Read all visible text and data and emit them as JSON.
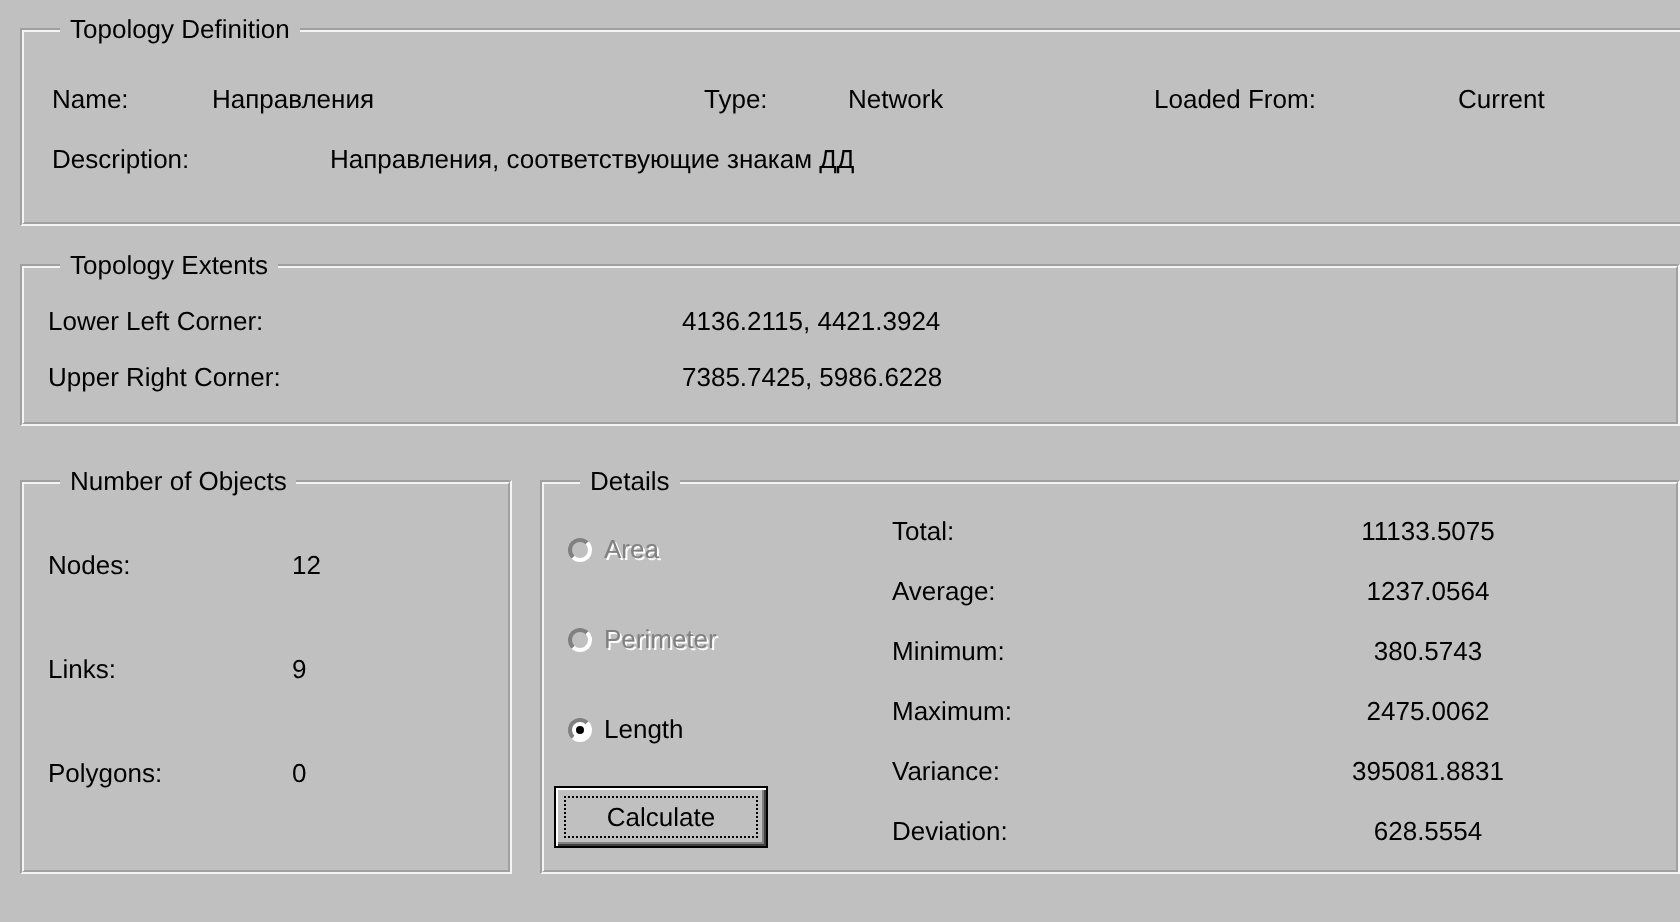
{
  "definition": {
    "title": "Topology Definition",
    "fields": [
      {
        "label": "Name:",
        "value": "Направления"
      },
      {
        "label": "Type:",
        "value": "Network"
      },
      {
        "label": "Loaded From:",
        "value": "Current"
      }
    ],
    "description": {
      "label": "Description:",
      "value": "Направления, соответствующие знакам ДД"
    }
  },
  "extents": {
    "title": "Topology Extents",
    "rows": [
      {
        "label": "Lower Left Corner:",
        "value": "4136.2115, 4421.3924"
      },
      {
        "label": "Upper Right Corner:",
        "value": "7385.7425, 5986.6228"
      }
    ]
  },
  "objects": {
    "title": "Number of Objects",
    "rows": [
      {
        "label": "Nodes:",
        "value": "12"
      },
      {
        "label": "Links:",
        "value": "9"
      },
      {
        "label": "Polygons:",
        "value": "0"
      }
    ]
  },
  "details": {
    "title": "Details",
    "options": [
      {
        "label": "Area",
        "selected": false,
        "disabled": true
      },
      {
        "label": "Perimeter",
        "selected": false,
        "disabled": true
      },
      {
        "label": "Length",
        "selected": true,
        "disabled": false
      }
    ],
    "button": "Calculate",
    "stats": [
      {
        "label": "Total:",
        "value": "11133.5075"
      },
      {
        "label": "Average:",
        "value": "1237.0564"
      },
      {
        "label": "Minimum:",
        "value": "380.5743"
      },
      {
        "label": "Maximum:",
        "value": "2475.0062"
      },
      {
        "label": "Variance:",
        "value": "395081.8831"
      },
      {
        "label": "Deviation:",
        "value": "628.5554"
      }
    ]
  }
}
